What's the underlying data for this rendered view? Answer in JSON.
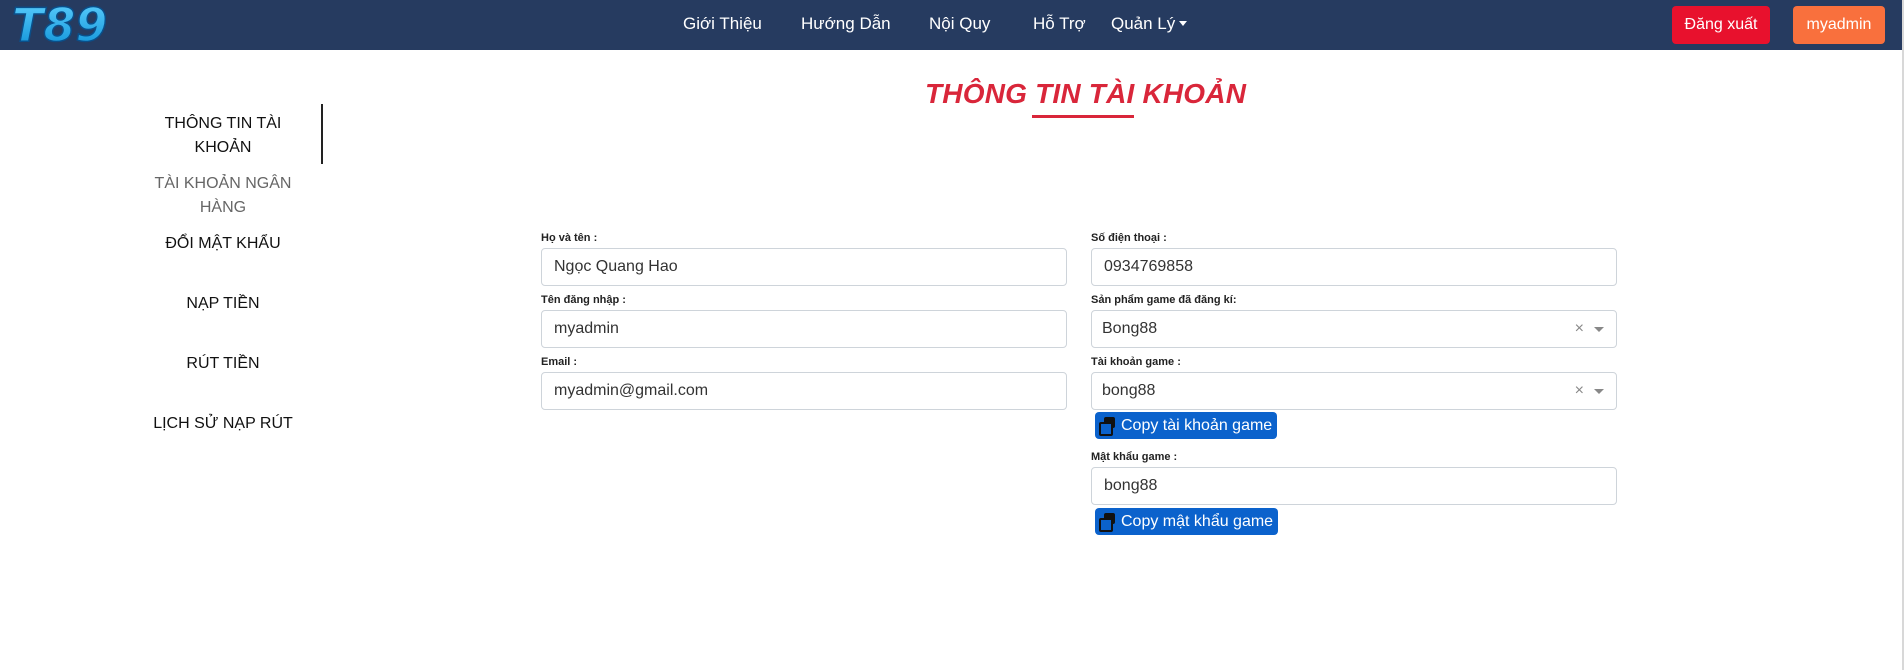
{
  "header": {
    "logo_text": "T89",
    "nav": [
      "Giới Thiệu",
      "Hướng Dẫn",
      "Nội Quy",
      "Hỗ Trợ",
      "Quản Lý"
    ],
    "logout_label": "Đăng xuất",
    "user_label": "myadmin"
  },
  "sidebar": {
    "items": [
      {
        "label": "THÔNG TIN TÀI KHOẢN",
        "active": true
      },
      {
        "label": "TÀI KHOẢN NGÂN HÀNG",
        "active": false
      },
      {
        "label": "ĐỔI MẬT KHẨU",
        "active": false
      },
      {
        "label": "NẠP TIỀN",
        "active": false
      },
      {
        "label": "RÚT TIỀN",
        "active": false
      },
      {
        "label": "LỊCH SỬ NẠP RÚT",
        "active": false
      }
    ]
  },
  "page": {
    "title": "THÔNG TIN TÀI KHOẢN"
  },
  "form": {
    "fullname_label": "Họ và tên :",
    "fullname_value": "Ngọc Quang Hao",
    "username_label": "Tên đăng nhập :",
    "username_value": "myadmin",
    "email_label": "Email :",
    "email_value": "myadmin@gmail.com",
    "phone_label": "Số điện thoại :",
    "phone_value": "0934769858",
    "game_product_label": "Sản phẩm game đã đăng kí:",
    "game_product_value": "Bong88",
    "game_account_label": "Tài khoản game :",
    "game_account_value": "bong88",
    "copy_account_label": "Copy tài khoản game",
    "game_password_label": "Mật khẩu game :",
    "game_password_value": "bong88",
    "copy_password_label": "Copy mật khẩu game"
  },
  "colors": {
    "navbar": "#263b60",
    "accent_red": "#d9263a",
    "logout": "#e8112d",
    "user": "#f9703d",
    "copy_button": "#0b62cc"
  }
}
